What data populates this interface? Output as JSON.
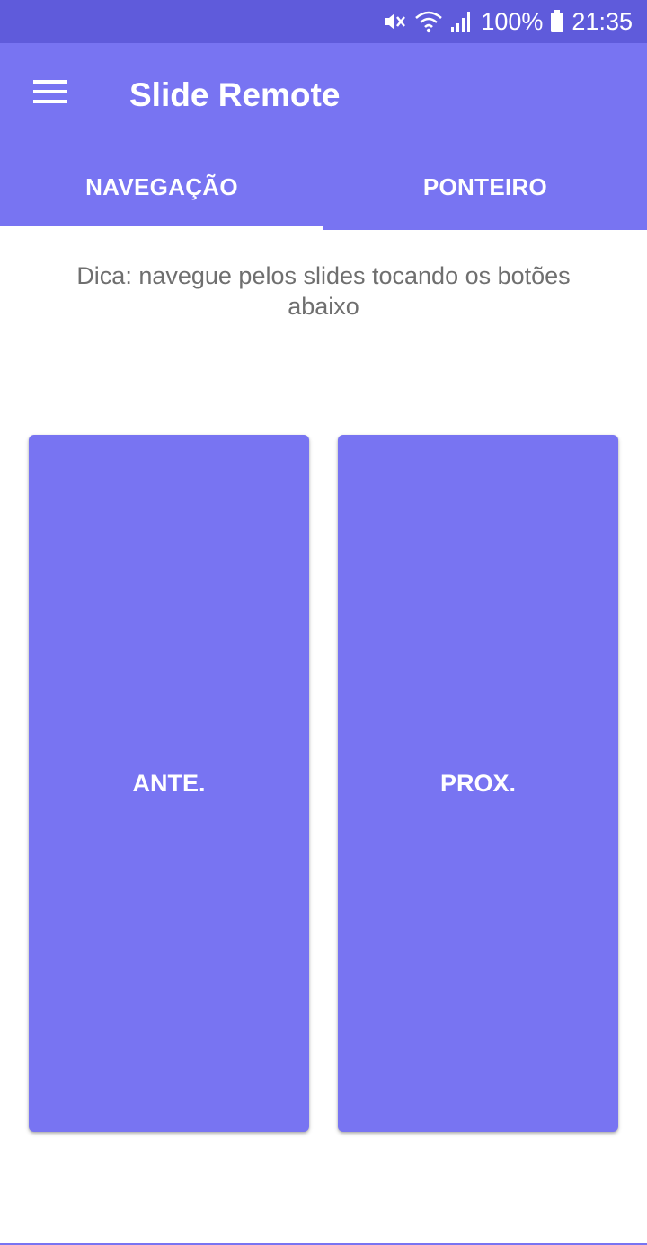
{
  "status_bar": {
    "battery": "100%",
    "time": "21:35",
    "icons": [
      "mute-icon",
      "wifi-icon",
      "signal-icon",
      "battery-icon"
    ]
  },
  "app_bar": {
    "title": "Slide Remote",
    "menu_icon": "hamburger-menu-icon"
  },
  "tabs": [
    {
      "label": "NAVEGAÇÃO",
      "selected": true
    },
    {
      "label": "PONTEIRO",
      "selected": false
    }
  ],
  "hint": "Dica: navegue pelos slides tocando os botões abaixo",
  "buttons": {
    "previous": "ANTE.",
    "next": "PROX."
  },
  "colors": {
    "status_bar": "#5f5bdb",
    "primary": "#7874f2",
    "hint_text": "#6f6f6f",
    "on_primary": "#ffffff"
  }
}
